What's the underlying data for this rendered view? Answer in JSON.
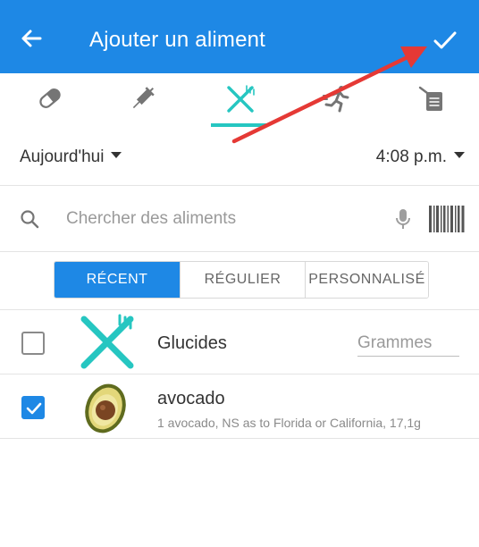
{
  "header": {
    "title": "Ajouter un aliment",
    "back_icon": "arrow-left-icon",
    "confirm_icon": "checkmark-icon",
    "background": "#1e88e5"
  },
  "category_tabs": {
    "items": [
      {
        "icon": "pill-icon",
        "active": false
      },
      {
        "icon": "syringe-icon",
        "active": false
      },
      {
        "icon": "fork-knife-icon",
        "active": true
      },
      {
        "icon": "running-person-icon",
        "active": false
      },
      {
        "icon": "notepad-icon",
        "active": false
      }
    ],
    "accent": "#26c6c1"
  },
  "date_row": {
    "date_label": "Aujourd'hui",
    "time_label": "4:08 p.m."
  },
  "search": {
    "placeholder": "Chercher des aliments",
    "value": ""
  },
  "segments": {
    "items": [
      {
        "label": "RÉCENT",
        "active": true
      },
      {
        "label": "RÉGULIER",
        "active": false
      },
      {
        "label": "PERSONNALISÉ",
        "active": false
      }
    ]
  },
  "foods": [
    {
      "name": "Glucides",
      "checked": false,
      "icon": "fork-knife-icon",
      "unit_placeholder": "Grammes"
    },
    {
      "name": "avocado",
      "checked": true,
      "icon": "avocado-icon",
      "detail": "1 avocado, NS as to Florida or California, 17,1g"
    }
  ],
  "annotation": {
    "color": "#e53935"
  }
}
